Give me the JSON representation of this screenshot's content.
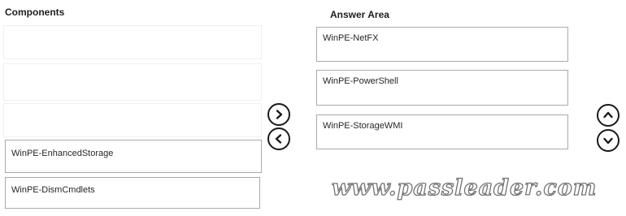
{
  "components": {
    "heading": "Components",
    "items": [
      "WinPE-EnhancedStorage",
      "WinPE-DismCmdlets"
    ]
  },
  "answer_area": {
    "heading": "Answer Area",
    "items": [
      "WinPE-NetFX",
      "WinPE-PowerShell",
      "WinPE-StorageWMI"
    ]
  },
  "controls": {
    "move_right_icon": "chevron-right-icon",
    "move_left_icon": "chevron-left-icon",
    "move_up_icon": "chevron-up-icon",
    "move_down_icon": "chevron-down-icon"
  },
  "watermark": "www.passleader.com"
}
